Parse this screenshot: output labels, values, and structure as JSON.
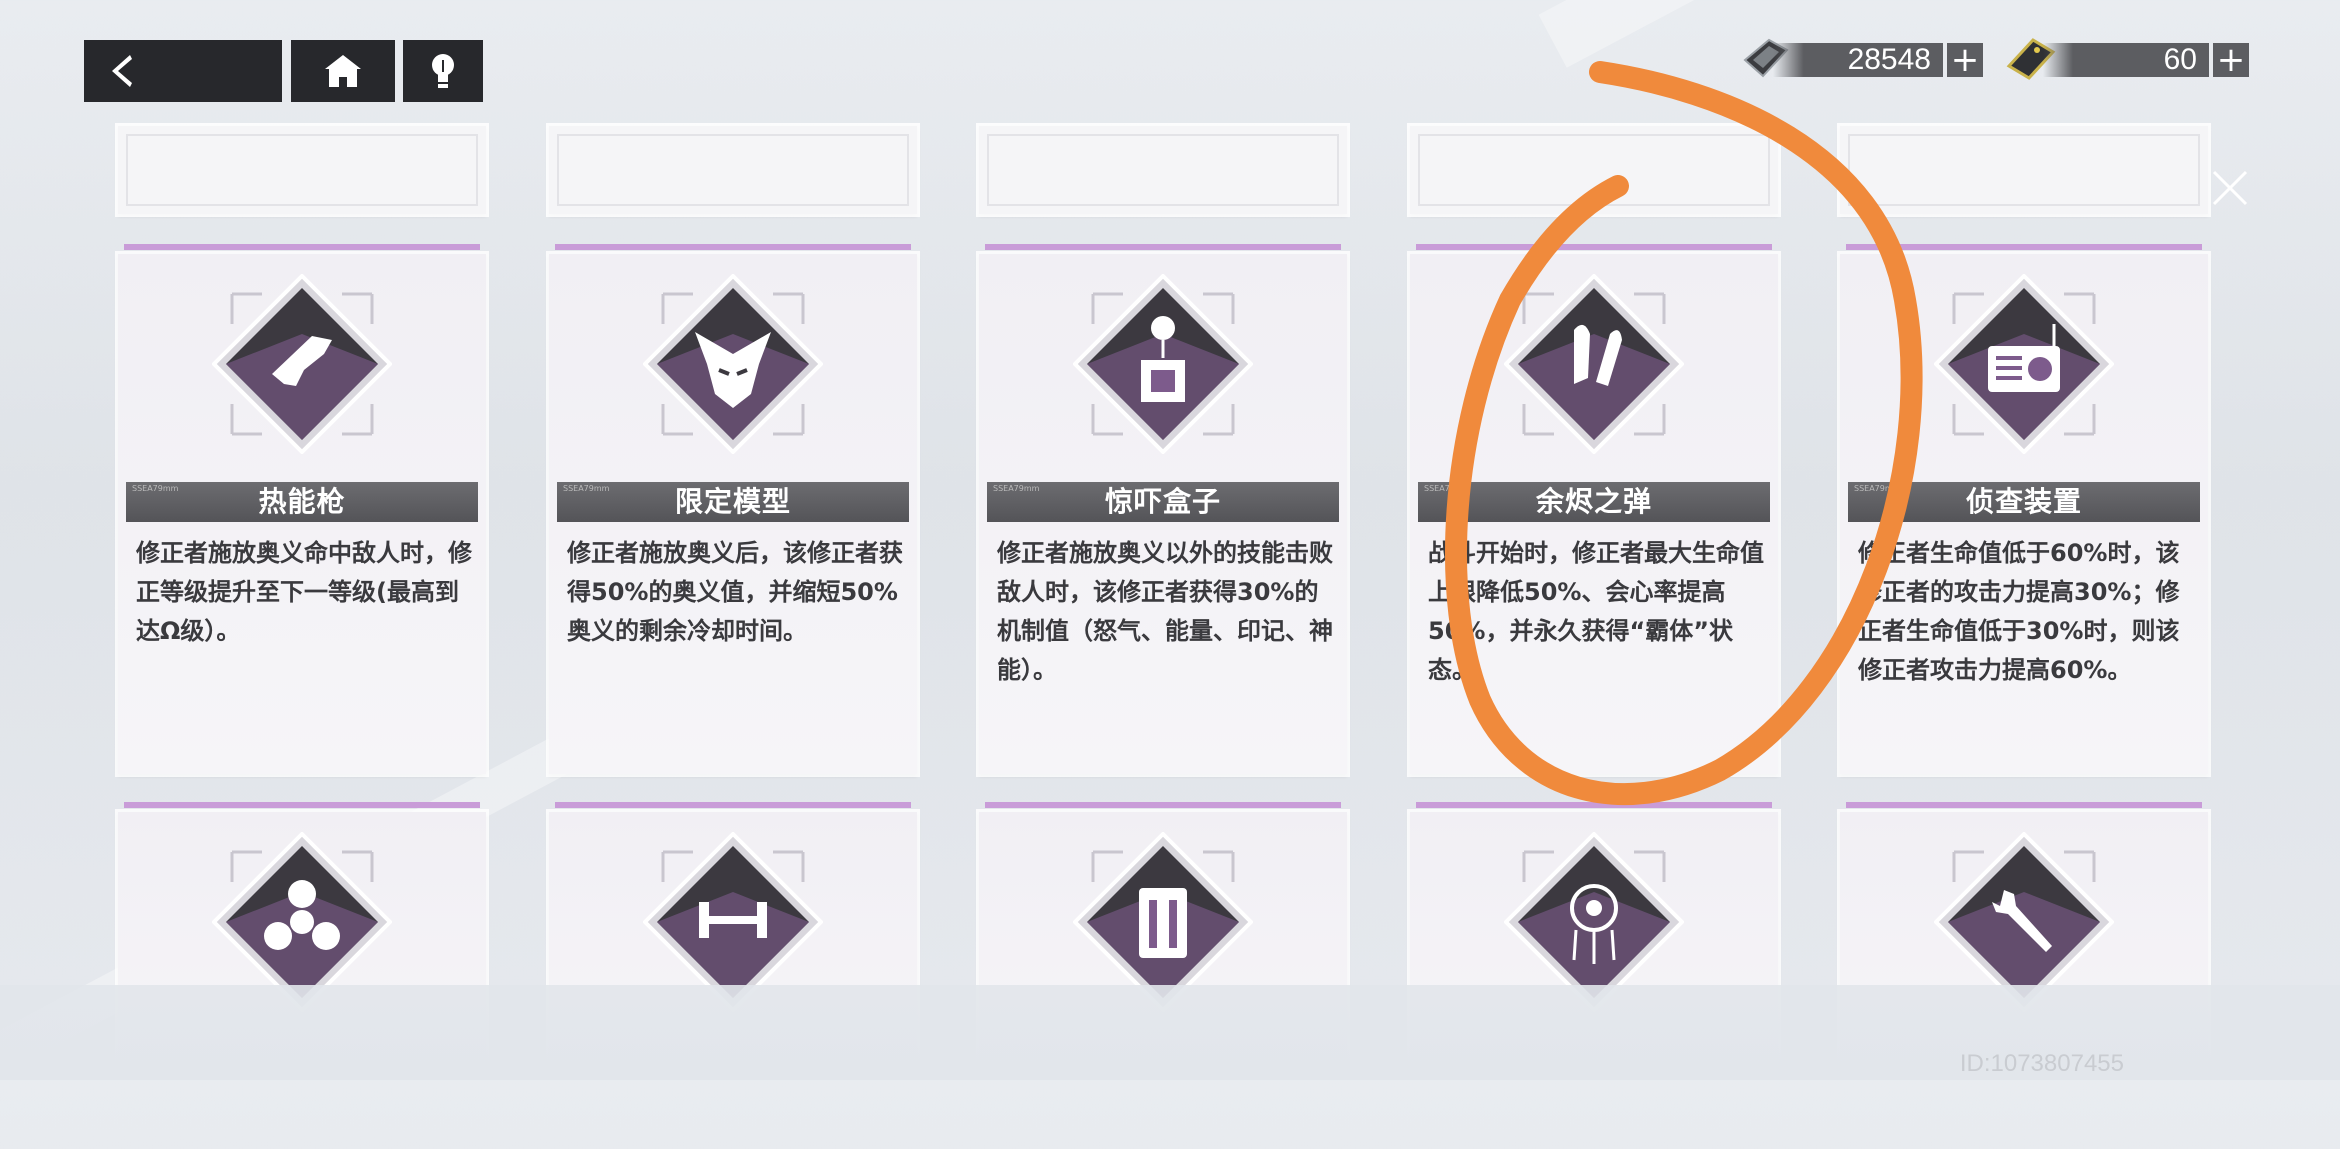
{
  "nav": {
    "back_icon": "back-arrow-icon",
    "home_icon": "home-icon",
    "hint_icon": "lightbulb-icon"
  },
  "currency": [
    {
      "icon": "diamond-currency-icon",
      "value": "28548",
      "plus": "+"
    },
    {
      "icon": "ticket-currency-icon",
      "value": "60",
      "plus": "+"
    }
  ],
  "cards_row1": [
    {
      "name": "热能枪",
      "icon": "heat-gun-icon",
      "tag": "SSEA79mm",
      "desc": "修正者施放奥义命中敌人时，修正等级提升至下一等级(最高到达Ω级）。"
    },
    {
      "name": "限定模型",
      "icon": "mecha-head-icon",
      "tag": "SSEA79mm",
      "desc": "修正者施放奥义后，该修正者获得50%的奥义值，并缩短50%奥义的剩余冷却时间。"
    },
    {
      "name": "惊吓盒子",
      "icon": "jack-in-box-icon",
      "tag": "SSEA79mm",
      "desc": "修正者施放奥义以外的技能击败敌人时，该修正者获得30%的机制值（怒气、能量、印记、神能）。"
    },
    {
      "name": "余烬之弹",
      "icon": "bullets-icon",
      "tag": "SSEA79mm",
      "desc": "战斗开始时，修正者最大生命值上限降低50%、会心率提高50%，并永久获得“霸体”状态。"
    },
    {
      "name": "侦查装置",
      "icon": "radio-device-icon",
      "tag": "SSEA79mm",
      "desc": "修正者生命值低于60%时，该修正者的攻击力提高30%；修正者生命值低于30%时，则该修正者攻击力提高60%。"
    }
  ],
  "cards_row2_icons": [
    "fidget-spinner-icon",
    "dumbbell-icon",
    "battery-canister-icon",
    "dreamcatcher-icon",
    "wrench-icon"
  ],
  "watermark": "ID:1073807455",
  "colors": {
    "accent": "#c99cd8",
    "icon_purple": "#9a68ad",
    "nav": "#27282c",
    "annotation": "#f08a3c"
  }
}
